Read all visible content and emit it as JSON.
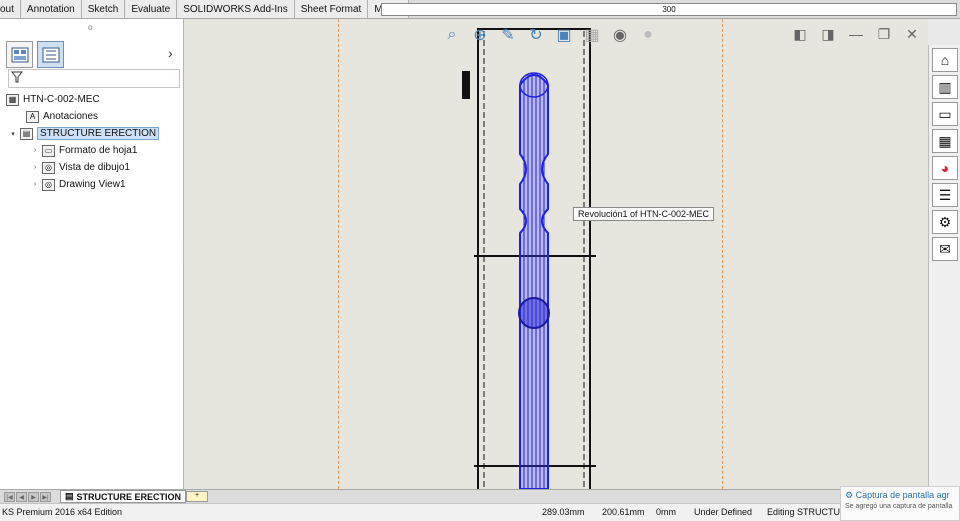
{
  "tabs": [
    "out",
    "Annotation",
    "Sketch",
    "Evaluate",
    "SOLIDWORKS Add-Ins",
    "Sheet Format",
    "Macro"
  ],
  "ruler_value": "300",
  "panel": {
    "handle": "o",
    "expand_arrow": "›",
    "tree": [
      {
        "label": "HTN-C-002-MEC",
        "icon": "drawing-icon",
        "indent": 0,
        "toggle": ""
      },
      {
        "label": "Anotaciones",
        "icon": "annotations-icon",
        "indent": 1,
        "toggle": ""
      },
      {
        "label": "STRUCTURE ERECTION",
        "icon": "sheet-icon",
        "indent": 0,
        "toggle": "▾",
        "selected": true
      },
      {
        "label": "Formato de hoja1",
        "icon": "sheet-format-icon",
        "indent": 2,
        "toggle": "›"
      },
      {
        "label": "Vista de dibujo1",
        "icon": "drawing-view-icon",
        "indent": 2,
        "toggle": "›"
      },
      {
        "label": "Drawing View1",
        "icon": "drawing-view-icon",
        "indent": 2,
        "toggle": "›"
      }
    ]
  },
  "hud_icons": [
    "zoom-to-fit-icon",
    "zoom-area-icon",
    "previous-view-icon",
    "rotate-icon",
    "view-orientation-icon",
    "display-style-icon",
    "hide-show-icon",
    "appearance-icon"
  ],
  "window_controls": [
    "restore-left-icon",
    "restore-right-icon",
    "minimize-icon",
    "maximize-icon",
    "close-icon"
  ],
  "tooltip": "Revolución1 of HTN-C-002-MEC",
  "taskpane_icons": [
    "home-icon",
    "design-library-icon",
    "file-explorer-icon",
    "view-palette-icon",
    "appearances-icon",
    "custom-properties-icon",
    "forum-icon",
    "chat-icon"
  ],
  "sheet_tab": "STRUCTURE ERECTION",
  "status": {
    "edition": "KS Premium 2016 x64 Edition",
    "x": "289.03mm",
    "y": "200.61mm",
    "z": "0mm",
    "state": "Under Defined",
    "editing": "Editing STRUCTURE ERECTION"
  },
  "notification": {
    "title": "Captura de pantalla agr",
    "subtitle": "Se agregó una captura de pantalla"
  },
  "colors": {
    "pipe": "#1f1fe8",
    "frame": "#111111",
    "dash": "#e59a5a"
  }
}
